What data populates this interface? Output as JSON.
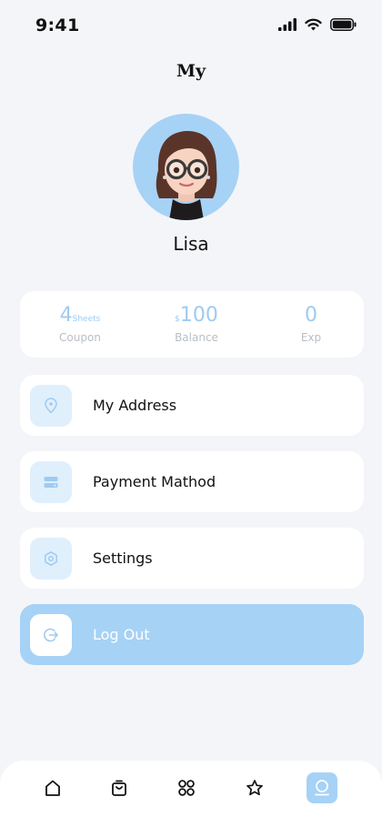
{
  "status_bar": {
    "time": "9:41"
  },
  "header": {
    "title": "My"
  },
  "profile": {
    "name": "Lisa"
  },
  "stats": {
    "coupon": {
      "value": "4",
      "unit": "Sheets",
      "label": "Coupon"
    },
    "balance": {
      "currency": "$",
      "value": "100",
      "label": "Balance"
    },
    "exp": {
      "value": "0",
      "label": "Exp"
    }
  },
  "menu": {
    "address": {
      "label": "My Address",
      "icon": "location-pin-icon"
    },
    "payment": {
      "label": "Payment Mathod",
      "icon": "card-icon"
    },
    "settings": {
      "label": "Settings",
      "icon": "gear-icon"
    },
    "logout": {
      "label": "Log Out",
      "icon": "logout-icon"
    }
  },
  "tabs": [
    {
      "icon": "home-icon",
      "active": false
    },
    {
      "icon": "shopping-bag-icon",
      "active": false
    },
    {
      "icon": "grid-icon",
      "active": false
    },
    {
      "icon": "star-icon",
      "active": false
    },
    {
      "icon": "profile-icon",
      "active": true
    }
  ],
  "colors": {
    "accent": "#a6d2f6",
    "accent_light": "#e0effc",
    "background": "#f4f5f8"
  }
}
